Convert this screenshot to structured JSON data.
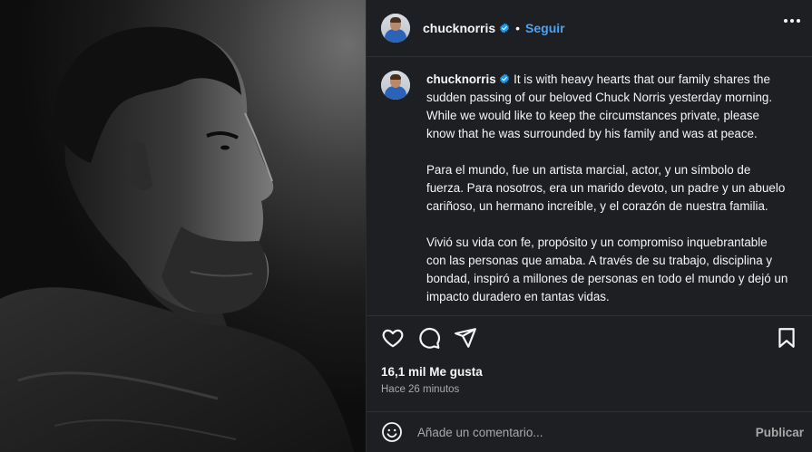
{
  "post": {
    "username": "chucknorris",
    "follow_label": "Seguir",
    "separator": "•",
    "caption_user": "chucknorris",
    "paragraphs": [
      "It is with heavy hearts that our family shares the sudden passing of our beloved Chuck Norris yesterday morning. While we would like to keep the circumstances private, please know that he was surrounded by his family and was at peace.",
      "Para el mundo, fue un artista marcial, actor, y un símbolo de fuerza. Para nosotros, era un marido devoto, un padre y un abuelo cariñoso, un hermano increíble, y el corazón de nuestra familia.",
      "Vivió su vida con fe, propósito y un compromiso inquebrantable con las personas que amaba. A través de su trabajo, disciplina y bondad, inspiró a millones de personas en todo el mundo y dejó un impacto duradero en tantas vidas."
    ],
    "likes": "16,1 mil Me gusta",
    "time": "Hace 26 minutos"
  },
  "comment": {
    "placeholder": "Añade un comentario...",
    "publish_label": "Publicar"
  },
  "icons": {
    "like": "heart-icon",
    "comment": "comment-icon",
    "share": "share-icon",
    "save": "bookmark-icon",
    "emoji": "emoji-icon",
    "more": "more-icon",
    "verified": "verified-badge-icon"
  },
  "colors": {
    "panel_bg": "#1e1f22",
    "link": "#4ba3f6",
    "verified": "#1d9bf0",
    "muted": "#a8a8a8"
  }
}
